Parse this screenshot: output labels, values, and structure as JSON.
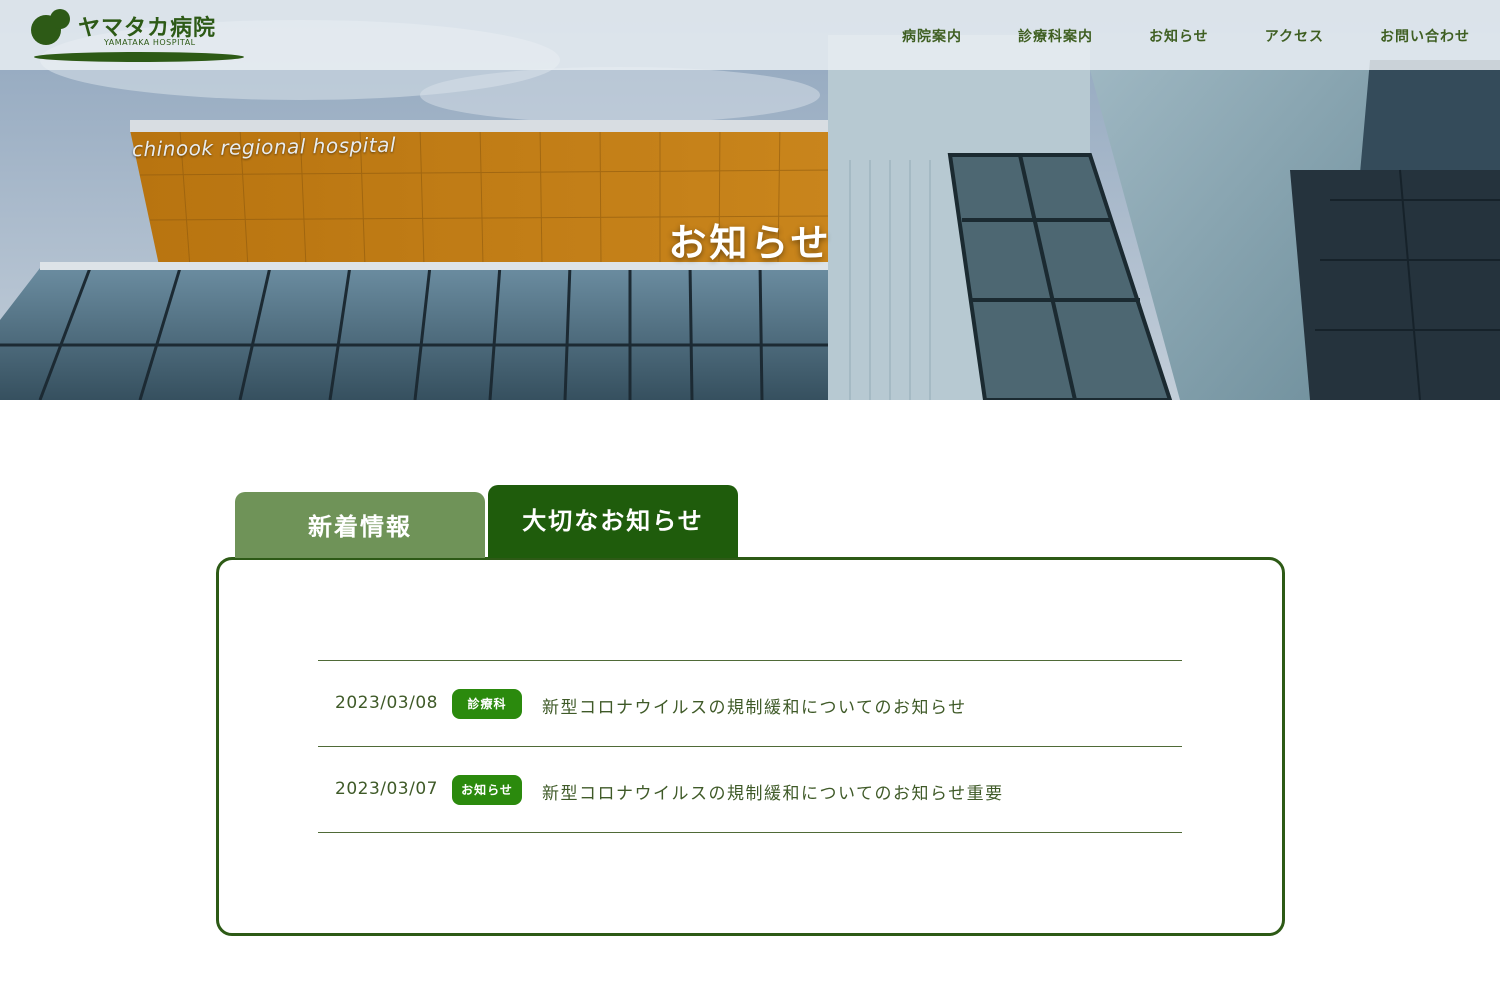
{
  "brand": {
    "name": "ヤマタカ病院",
    "sub": "YAMATAKA HOSPITAL",
    "color": "#2d5a16"
  },
  "nav": {
    "items": [
      "病院案内",
      "診療科案内",
      "お知らせ",
      "アクセス",
      "お問い合わせ"
    ]
  },
  "hero": {
    "title": "お知らせ",
    "building_sign": "chinook regional hospital"
  },
  "tabs": {
    "news": "新着情報",
    "important": "大切なお知らせ",
    "active": "important"
  },
  "news": [
    {
      "date": "2023/03/08",
      "category": "診療科",
      "title": "新型コロナウイルスの規制緩和についてのお知らせ"
    },
    {
      "date": "2023/03/07",
      "category": "お知らせ",
      "title": "新型コロナウイルスの規制緩和についてのお知らせ重要"
    }
  ],
  "colors": {
    "accent": "#1f5c0c",
    "tab_inactive": "#6f9358",
    "badge": "#2b8a0d",
    "text": "#3f5a28"
  }
}
